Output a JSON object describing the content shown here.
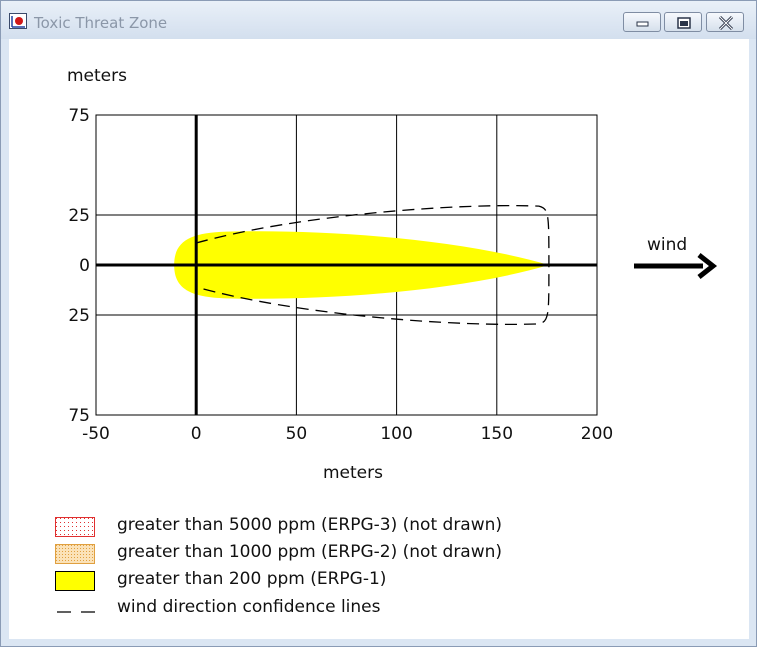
{
  "window": {
    "title": "Toxic Threat Zone",
    "controls": [
      "minimize",
      "restore",
      "close"
    ]
  },
  "chart_data": {
    "type": "area",
    "title": "",
    "y_unit_label": "meters",
    "xlabel": "meters",
    "xlim": [
      -50,
      200
    ],
    "ylim": [
      -75,
      75
    ],
    "x_ticks": [
      "-50",
      "0",
      "50",
      "100",
      "150",
      "200"
    ],
    "y_ticks": [
      "75",
      "25",
      "0",
      "25",
      "75"
    ],
    "grid": true,
    "wind_label": "wind",
    "wind_direction": "right",
    "series": [
      {
        "name": "greater than 200 ppm (ERPG-1)",
        "color": "#ffff00",
        "shape": "plume",
        "x_start": -11,
        "x_end": 176,
        "max_half_width": 17
      },
      {
        "name": "wind direction confidence lines",
        "style": "dashed",
        "color": "#000000",
        "x_start": 0,
        "x_end": 176,
        "max_half_width": 32
      }
    ]
  },
  "legend": [
    {
      "label": "greater than 5000 ppm (ERPG-3) (not drawn)",
      "swatch": "dotted-red"
    },
    {
      "label": "greater than 1000 ppm (ERPG-2) (not drawn)",
      "swatch": "dotted-orange"
    },
    {
      "label": "greater than 200 ppm (ERPG-1)",
      "swatch": "solid-yellow"
    },
    {
      "label": "wind direction confidence lines",
      "swatch": "dashed-line"
    }
  ],
  "colors": {
    "erpg3_border": "#e03030",
    "erpg2_fill": "#fbe2b8",
    "erpg2_border": "#e0a040",
    "erpg1_fill": "#ffff00"
  }
}
